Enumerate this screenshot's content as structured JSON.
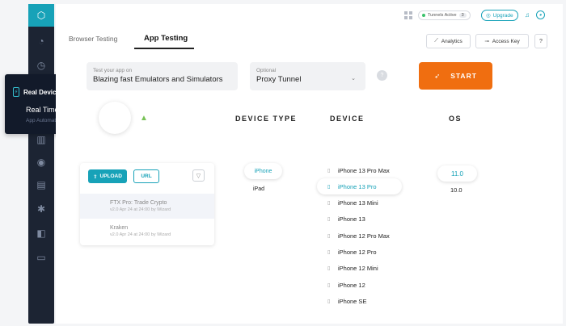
{
  "colors": {
    "accent": "#17a2b8",
    "start": "#f06e10",
    "sidebar": "#1c2433"
  },
  "flyout": {
    "title": "Real Device Cloud",
    "items": [
      "Real Time",
      "App Automation"
    ]
  },
  "topbar": {
    "tunnel_label": "Tunnels Active",
    "tunnel_count": "3",
    "upgrade_label": "Upgrade"
  },
  "tabs": [
    {
      "label": "Browser Testing"
    },
    {
      "label": "App Testing",
      "active": true
    }
  ],
  "toolbar": {
    "analytics_label": "Analytics",
    "access_key_label": "Access Key",
    "help_label": "?"
  },
  "app_input": {
    "label": "Test your app on",
    "value": "Blazing fast Emulators and Simulators"
  },
  "proxy": {
    "label": "Optional",
    "value": "Proxy Tunnel"
  },
  "start_label": "START",
  "columns": {
    "device_type": "DEVICE TYPE",
    "device": "DEVICE",
    "os": "OS"
  },
  "upload": {
    "upload_label": "UPLOAD",
    "url_label": "URL"
  },
  "apps": [
    {
      "name": "FTX Pro: Trade Crypto",
      "meta": "v2.0 Apr 24 at 24:00 by Wizard"
    },
    {
      "name": "Kraken",
      "meta": "v2.0 Apr 24 at 24:00 by Wizard"
    }
  ],
  "device_types": [
    "iPhone",
    "iPad"
  ],
  "devices": [
    "iPhone 13 Pro Max",
    "iPhone 13 Pro",
    "iPhone 13 Mini",
    "iPhone 13",
    "iPhone 12 Pro Max",
    "iPhone 12 Pro",
    "iPhone 12 Mini",
    "iPhone 12",
    "iPhone SE"
  ],
  "os_versions": [
    "11.0",
    "10.0"
  ]
}
